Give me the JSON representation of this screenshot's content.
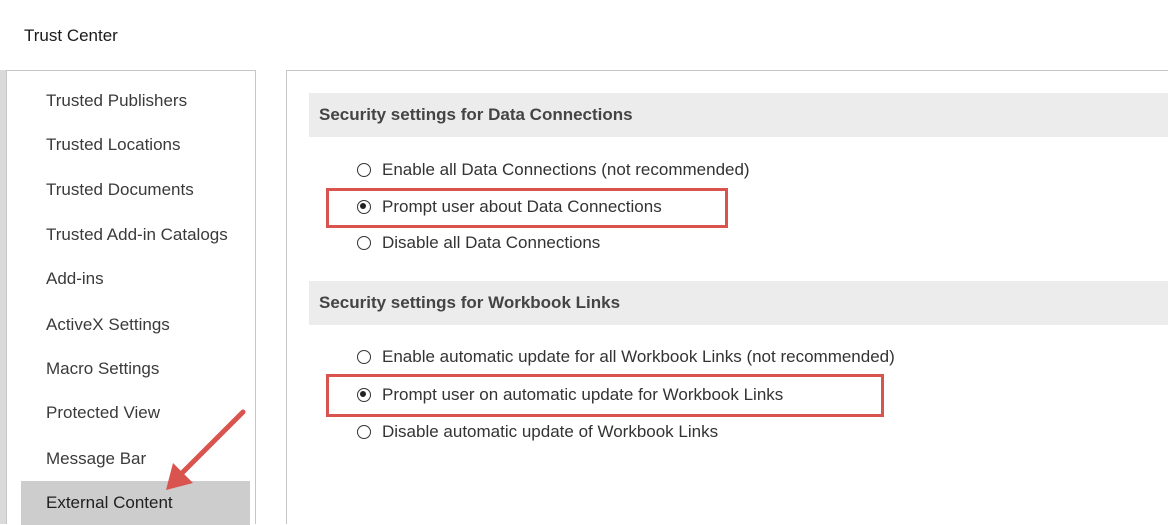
{
  "window": {
    "title": "Trust Center"
  },
  "sidebar": {
    "items": [
      {
        "label": "Trusted Publishers",
        "selected": false
      },
      {
        "label": "Trusted Locations",
        "selected": false
      },
      {
        "label": "Trusted Documents",
        "selected": false
      },
      {
        "label": "Trusted Add-in Catalogs",
        "selected": false
      },
      {
        "label": "Add-ins",
        "selected": false
      },
      {
        "label": "ActiveX Settings",
        "selected": false
      },
      {
        "label": "Macro Settings",
        "selected": false
      },
      {
        "label": "Protected View",
        "selected": false
      },
      {
        "label": "Message Bar",
        "selected": false
      },
      {
        "label": "External Content",
        "selected": true
      }
    ]
  },
  "sections": {
    "data_connections": {
      "header": "Security settings for Data Connections",
      "options": [
        {
          "label": "Enable all Data Connections (not recommended)",
          "checked": false
        },
        {
          "label": "Prompt user about Data Connections",
          "checked": true
        },
        {
          "label": "Disable all Data Connections",
          "checked": false
        }
      ]
    },
    "workbook_links": {
      "header": "Security settings for Workbook Links",
      "options": [
        {
          "label": "Enable automatic update for all Workbook Links (not recommended)",
          "checked": false
        },
        {
          "label": "Prompt user on automatic update for Workbook Links",
          "checked": true
        },
        {
          "label": "Disable automatic update of Workbook Links",
          "checked": false
        }
      ]
    }
  },
  "colors": {
    "annotation": "#d9534f",
    "selected_item": "#cdcdcd",
    "section_header_bg": "#ececec"
  }
}
